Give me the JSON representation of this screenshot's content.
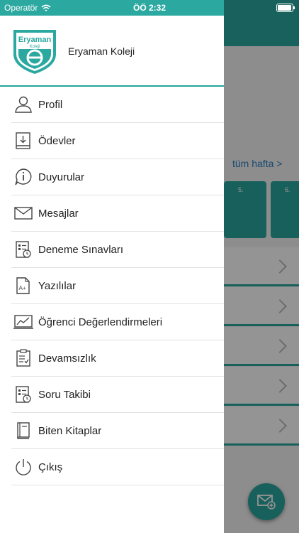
{
  "status_bar": {
    "carrier": "Operatör",
    "time": "ÖÖ 2:32"
  },
  "school": {
    "name": "Eryaman Koleji",
    "logo_text": "Eryaman",
    "logo_subtext": "Koleji"
  },
  "menu": [
    {
      "label": "Profil",
      "icon": "user-icon"
    },
    {
      "label": "Ödevler",
      "icon": "download-tray-icon"
    },
    {
      "label": "Duyurular",
      "icon": "info-bubble-icon"
    },
    {
      "label": "Mesajlar",
      "icon": "envelope-icon"
    },
    {
      "label": "Deneme Sınavları",
      "icon": "exam-list-icon"
    },
    {
      "label": "Yazılılar",
      "icon": "grade-doc-icon"
    },
    {
      "label": "Öğrenci Değerlendirmeleri",
      "icon": "chart-monitor-icon"
    },
    {
      "label": "Devamsızlık",
      "icon": "clipboard-check-icon"
    },
    {
      "label": "Soru Takibi",
      "icon": "question-list-icon"
    },
    {
      "label": "Biten Kitaplar",
      "icon": "book-icon"
    },
    {
      "label": "Çıkış",
      "icon": "power-icon"
    }
  ],
  "background": {
    "week_link": "tüm hafta >",
    "day_cards": [
      "5.",
      "6."
    ]
  },
  "colors": {
    "accent": "#2ba8a0",
    "dim_overlay": "rgba(0,0,0,0.42)"
  }
}
